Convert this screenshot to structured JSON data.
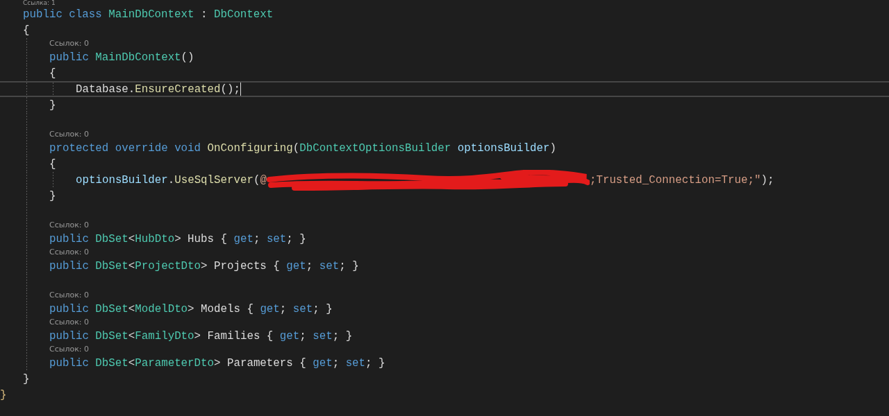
{
  "editor": {
    "lines": [
      {
        "kind": "lens",
        "text": "Ссылка: 1"
      },
      {
        "kind": "code",
        "tokens": [
          {
            "t": "public ",
            "kind": "keyword"
          },
          {
            "t": "class ",
            "kind": "keyword"
          },
          {
            "t": "MainDbContext",
            "kind": "type"
          },
          {
            "t": " : "
          },
          {
            "t": "DbContext",
            "kind": "type"
          }
        ]
      },
      {
        "kind": "code",
        "tokens": [
          {
            "t": "{"
          }
        ],
        "children": [
          {
            "kind": "lens",
            "text": "Ссылок: 0"
          },
          {
            "kind": "code",
            "tokens": [
              {
                "t": "public ",
                "kind": "keyword"
              },
              {
                "t": "MainDbContext",
                "kind": "type"
              },
              {
                "t": "()"
              }
            ]
          },
          {
            "kind": "code",
            "tokens": [
              {
                "t": "{"
              }
            ],
            "children": [
              {
                "kind": "code",
                "current": true,
                "tokens": [
                  {
                    "t": "Database."
                  },
                  {
                    "t": "EnsureCreated",
                    "kind": "method"
                  },
                  {
                    "t": "();"
                  }
                ]
              }
            ]
          },
          {
            "kind": "code",
            "tokens": [
              {
                "t": "}"
              }
            ]
          },
          {
            "kind": "blank"
          },
          {
            "kind": "lens",
            "text": "Ссылок: 0"
          },
          {
            "kind": "code",
            "tokens": [
              {
                "t": "protected ",
                "kind": "keyword"
              },
              {
                "t": "override ",
                "kind": "keyword"
              },
              {
                "t": "void ",
                "kind": "keyword"
              },
              {
                "t": "OnConfiguring",
                "kind": "method"
              },
              {
                "t": "("
              },
              {
                "t": "DbContextOptionsBuilder ",
                "kind": "type"
              },
              {
                "t": "optionsBuilder",
                "kind": "param"
              },
              {
                "t": ")"
              }
            ]
          },
          {
            "kind": "code",
            "tokens": [
              {
                "t": "{"
              }
            ],
            "children": [
              {
                "kind": "code",
                "tokens": [
                  {
                    "t": "optionsBuilder",
                    "kind": "param"
                  },
                  {
                    "t": "."
                  },
                  {
                    "t": "UseSqlServer",
                    "kind": "method"
                  },
                  {
                    "t": "("
                  },
                  {
                    "t": "@",
                    "kind": "string"
                  },
                  {
                    "kind": "redaction"
                  },
                  {
                    "t": ";Trusted_Connection=True;\"",
                    "kind": "string"
                  },
                  {
                    "t": ");"
                  }
                ]
              }
            ]
          },
          {
            "kind": "code",
            "tokens": [
              {
                "t": "}"
              }
            ]
          },
          {
            "kind": "blank"
          },
          {
            "kind": "lens",
            "text": "Ссылок: 0"
          },
          {
            "kind": "code",
            "tokens": [
              {
                "t": "public ",
                "kind": "keyword"
              },
              {
                "t": "DbSet",
                "kind": "type"
              },
              {
                "t": "<"
              },
              {
                "t": "HubDto",
                "kind": "type"
              },
              {
                "t": "> Hubs { "
              },
              {
                "t": "get",
                "kind": "keyword"
              },
              {
                "t": "; "
              },
              {
                "t": "set",
                "kind": "keyword"
              },
              {
                "t": "; }"
              }
            ]
          },
          {
            "kind": "lens",
            "text": "Ссылок: 0"
          },
          {
            "kind": "code",
            "tokens": [
              {
                "t": "public ",
                "kind": "keyword"
              },
              {
                "t": "DbSet",
                "kind": "type"
              },
              {
                "t": "<"
              },
              {
                "t": "ProjectDto",
                "kind": "type"
              },
              {
                "t": "> Projects { "
              },
              {
                "t": "get",
                "kind": "keyword"
              },
              {
                "t": "; "
              },
              {
                "t": "set",
                "kind": "keyword"
              },
              {
                "t": "; }"
              }
            ]
          },
          {
            "kind": "blank"
          },
          {
            "kind": "lens",
            "text": "Ссылок: 0"
          },
          {
            "kind": "code",
            "tokens": [
              {
                "t": "public ",
                "kind": "keyword"
              },
              {
                "t": "DbSet",
                "kind": "type"
              },
              {
                "t": "<"
              },
              {
                "t": "ModelDto",
                "kind": "type"
              },
              {
                "t": "> Models { "
              },
              {
                "t": "get",
                "kind": "keyword"
              },
              {
                "t": "; "
              },
              {
                "t": "set",
                "kind": "keyword"
              },
              {
                "t": "; }"
              }
            ]
          },
          {
            "kind": "lens",
            "text": "Ссылок: 0"
          },
          {
            "kind": "code",
            "tokens": [
              {
                "t": "public ",
                "kind": "keyword"
              },
              {
                "t": "DbSet",
                "kind": "type"
              },
              {
                "t": "<"
              },
              {
                "t": "FamilyDto",
                "kind": "type"
              },
              {
                "t": "> Families { "
              },
              {
                "t": "get",
                "kind": "keyword"
              },
              {
                "t": "; "
              },
              {
                "t": "set",
                "kind": "keyword"
              },
              {
                "t": "; }"
              }
            ]
          },
          {
            "kind": "lens",
            "text": "Ссылок: 0"
          },
          {
            "kind": "code",
            "tokens": [
              {
                "t": "public ",
                "kind": "keyword"
              },
              {
                "t": "DbSet",
                "kind": "type"
              },
              {
                "t": "<"
              },
              {
                "t": "ParameterDto",
                "kind": "type"
              },
              {
                "t": "> Parameters { "
              },
              {
                "t": "get",
                "kind": "keyword"
              },
              {
                "t": "; "
              },
              {
                "t": "set",
                "kind": "keyword"
              },
              {
                "t": "; }"
              }
            ]
          }
        ]
      },
      {
        "kind": "code",
        "tokens": [
          {
            "t": "}"
          }
        ]
      },
      {
        "kind": "edge",
        "tokens": [
          {
            "t": "}",
            "kind": "match"
          }
        ]
      }
    ]
  }
}
